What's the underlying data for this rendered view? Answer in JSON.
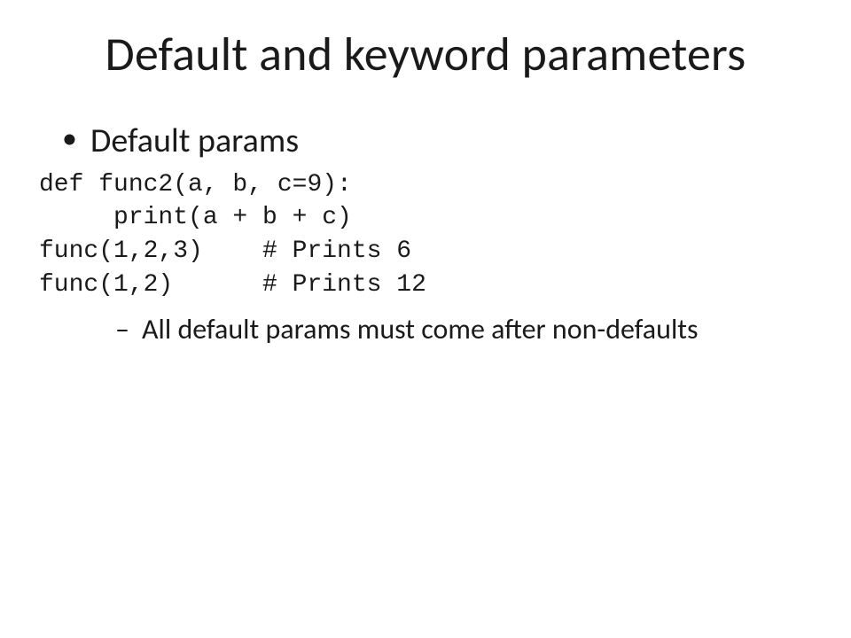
{
  "title": "Default and keyword parameters",
  "bullet1": "Default params",
  "code": {
    "line1": "def func2(a, b, c=9):",
    "line2": "     print(a + b + c)",
    "line3": "func(1,2,3)    # Prints 6",
    "line4": "func(1,2)      # Prints 12"
  },
  "sub1": "All default params must come after non-defaults"
}
